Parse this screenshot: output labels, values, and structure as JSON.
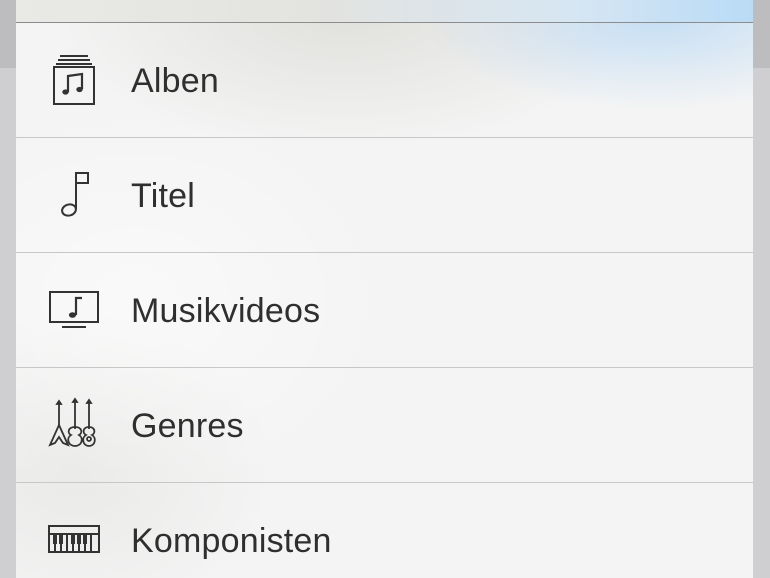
{
  "menu": {
    "items": [
      {
        "label": "Alben",
        "icon": "album-stack-icon"
      },
      {
        "label": "Titel",
        "icon": "music-note-icon"
      },
      {
        "label": "Musikvideos",
        "icon": "music-video-icon"
      },
      {
        "label": "Genres",
        "icon": "guitars-icon"
      },
      {
        "label": "Komponisten",
        "icon": "piano-keys-icon"
      }
    ]
  },
  "colors": {
    "text": "#2f2f2f",
    "icon": "#333333",
    "separator": "#c7c7c7",
    "sheet": "#f4f4f4",
    "accent_blur": "#b9dbf6"
  }
}
